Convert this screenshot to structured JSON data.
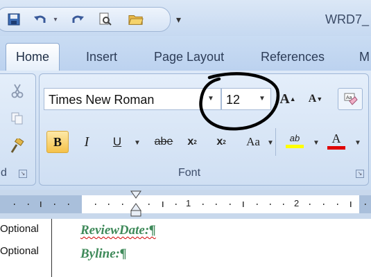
{
  "title_bar": {
    "document_title": "WRD7_",
    "quick_access": [
      {
        "name": "save-icon",
        "glyph": "🖫"
      },
      {
        "name": "undo-icon",
        "glyph": "↶"
      },
      {
        "name": "redo-icon",
        "glyph": "↷"
      },
      {
        "name": "print-preview-icon",
        "glyph": "🔍"
      },
      {
        "name": "open-folder-icon",
        "glyph": "📂"
      },
      {
        "name": "customize-qat-icon",
        "glyph": "▾"
      }
    ]
  },
  "tabs": [
    "Home",
    "Insert",
    "Page Layout",
    "References",
    "M"
  ],
  "active_tab": "Home",
  "ribbon": {
    "clipboard_group_label": "d",
    "font_group_label": "Font",
    "font_name": "Times New Roman",
    "font_size": "12",
    "format_buttons": {
      "bold": "B",
      "italic": "I",
      "underline": "U",
      "strikethrough": "abe",
      "subscript": "x",
      "superscript": "x",
      "change_case": "Aa",
      "grow_font": "A",
      "shrink_font": "A",
      "highlight": "ab",
      "font_color": "A"
    },
    "colors": {
      "highlight": "#ffff00",
      "font_color": "#e00000",
      "annotation_circle": "#000000"
    }
  },
  "ruler": {
    "numbers": [
      "1",
      "2"
    ]
  },
  "document": {
    "style_area": [
      "Optional",
      "Optional"
    ],
    "lines": [
      "ReviewDate:¶",
      "Byline:¶"
    ]
  }
}
